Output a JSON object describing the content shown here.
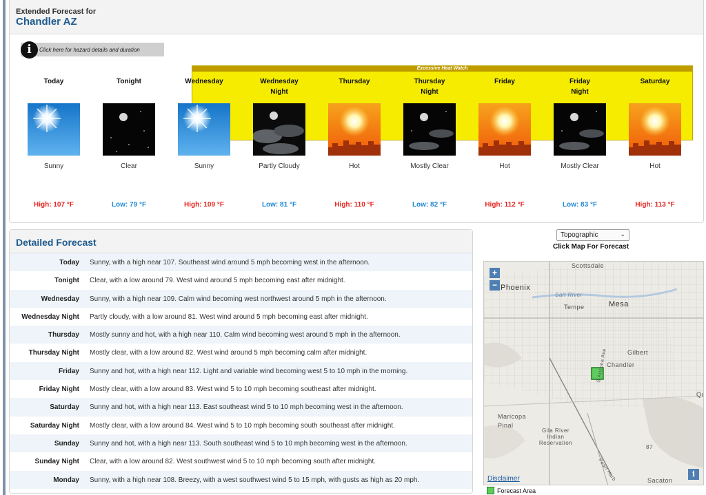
{
  "extended": {
    "heading": "Extended Forecast for",
    "location": "Chandler AZ",
    "hazard_link": "Click here for hazard details and duration",
    "hazard_banner": "Excessive Heat Watch",
    "periods": [
      {
        "name": "Today",
        "short": "Sunny",
        "temp": "High: 107 °F",
        "kind": "high",
        "icon": "sunny-icon"
      },
      {
        "name": "Tonight",
        "short": "Clear",
        "temp": "Low: 79 °F",
        "kind": "low",
        "icon": "clear-night-icon"
      },
      {
        "name": "Wednesday",
        "short": "Sunny",
        "temp": "High: 109 °F",
        "kind": "high",
        "icon": "sunny-icon"
      },
      {
        "name": "Wednesday Night",
        "short": "Partly Cloudy",
        "temp": "Low: 81 °F",
        "kind": "low",
        "icon": "partly-cloudy-night-icon"
      },
      {
        "name": "Thursday",
        "short": "Hot",
        "temp": "High: 110 °F",
        "kind": "high",
        "icon": "hot-icon"
      },
      {
        "name": "Thursday Night",
        "short": "Mostly Clear",
        "temp": "Low: 82 °F",
        "kind": "low",
        "icon": "mostly-clear-night-icon"
      },
      {
        "name": "Friday",
        "short": "Hot",
        "temp": "High: 112 °F",
        "kind": "high",
        "icon": "hot-icon"
      },
      {
        "name": "Friday Night",
        "short": "Mostly Clear",
        "temp": "Low: 83 °F",
        "kind": "low",
        "icon": "mostly-clear-night-icon"
      },
      {
        "name": "Saturday",
        "short": "Hot",
        "temp": "High: 113 °F",
        "kind": "high",
        "icon": "hot-icon"
      }
    ]
  },
  "detailed": {
    "title": "Detailed Forecast",
    "rows": [
      {
        "label": "Today",
        "text": "Sunny, with a high near 107. Southeast wind around 5 mph becoming west in the afternoon."
      },
      {
        "label": "Tonight",
        "text": "Clear, with a low around 79. West wind around 5 mph becoming east after midnight."
      },
      {
        "label": "Wednesday",
        "text": "Sunny, with a high near 109. Calm wind becoming west northwest around 5 mph in the afternoon."
      },
      {
        "label": "Wednesday Night",
        "text": "Partly cloudy, with a low around 81. West wind around 5 mph becoming east after midnight."
      },
      {
        "label": "Thursday",
        "text": "Mostly sunny and hot, with a high near 110. Calm wind becoming west around 5 mph in the afternoon."
      },
      {
        "label": "Thursday Night",
        "text": "Mostly clear, with a low around 82. West wind around 5 mph becoming calm after midnight."
      },
      {
        "label": "Friday",
        "text": "Sunny and hot, with a high near 112. Light and variable wind becoming west 5 to 10 mph in the morning."
      },
      {
        "label": "Friday Night",
        "text": "Mostly clear, with a low around 83. West wind 5 to 10 mph becoming southeast after midnight."
      },
      {
        "label": "Saturday",
        "text": "Sunny and hot, with a high near 113. East southeast wind 5 to 10 mph becoming west in the afternoon."
      },
      {
        "label": "Saturday Night",
        "text": "Mostly clear, with a low around 84. West wind 5 to 10 mph becoming south southeast after midnight."
      },
      {
        "label": "Sunday",
        "text": "Sunny and hot, with a high near 113. South southeast wind 5 to 10 mph becoming west in the afternoon."
      },
      {
        "label": "Sunday Night",
        "text": "Clear, with a low around 82. West southwest wind 5 to 10 mph becoming south after midnight."
      },
      {
        "label": "Monday",
        "text": "Sunny, with a high near 108. Breezy, with a west southwest wind 5 to 15 mph, with gusts as high as 20 mph."
      }
    ]
  },
  "map": {
    "basemap_selected": "Topographic",
    "hint": "Click Map For Forecast",
    "zoom_in": "+",
    "zoom_out": "−",
    "labels": {
      "scottsdale": "Scottsdale",
      "phoenix": "Phoenix",
      "salt_river": "Salt River",
      "tempe": "Tempe",
      "mesa": "Mesa",
      "gilbert": "Gilbert",
      "chandler": "Chandler",
      "arizona_ave": "S Arizona Ave",
      "maricopa": "Maricopa",
      "pinal": "Pinal",
      "gila_river": "Gila River Indian Reservation",
      "sacaton": "Sacaton",
      "pearl_harbor": "Pearl Harb",
      "num_87": "87",
      "edge_qu": "Qu"
    },
    "disclaimer": "Disclaimer",
    "info": "i",
    "legend": "Forecast Area"
  },
  "colors": {
    "accent_blue": "#1d5a8e",
    "high_temp": "#e3261f",
    "low_temp": "#1e88d4",
    "watch_yellow": "#f5ec00",
    "forecast_area_green": "#5ecc5e"
  }
}
